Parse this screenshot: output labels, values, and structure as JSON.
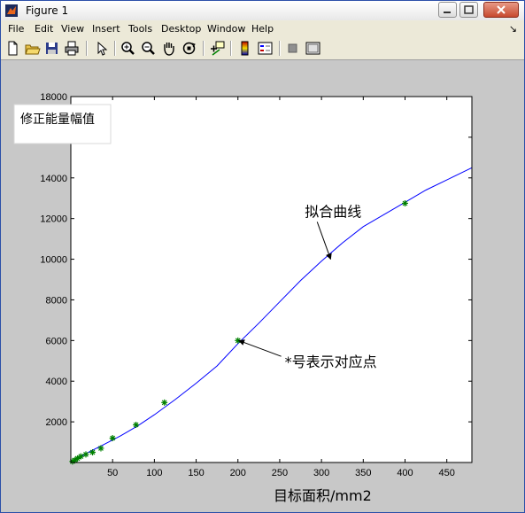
{
  "window": {
    "title": "Figure 1",
    "buttons": {
      "minimize": "0",
      "maximize": "1",
      "close": "r"
    }
  },
  "menu": {
    "items": [
      "File",
      "Edit",
      "View",
      "Insert",
      "Tools",
      "Desktop",
      "Window",
      "Help"
    ],
    "overflow_arrow": "↘"
  },
  "toolbar": {
    "icons": [
      "new-figure-icon",
      "open-file-icon",
      "save-icon",
      "print-icon",
      "pointer-icon",
      "zoom-in-icon",
      "zoom-out-icon",
      "pan-hand-icon",
      "rotate-3d-icon",
      "data-cursor-icon",
      "colorbar-icon",
      "legend-icon",
      "hide-plot-tools-icon",
      "show-plot-tools-icon"
    ]
  },
  "colors": {
    "curve": "#0000ff",
    "markers": "#008000",
    "figure_bg": "#c8c8c8"
  },
  "chart_data": {
    "type": "line",
    "title": "",
    "ylabel_box": "修正能量幅值",
    "xlabel": "目标面积/mm2",
    "xlim": [
      0,
      480
    ],
    "ylim": [
      0,
      18000
    ],
    "xticks": [
      50,
      100,
      150,
      200,
      250,
      300,
      350,
      400,
      450
    ],
    "yticks": [
      2000,
      4000,
      6000,
      8000,
      10000,
      12000,
      14000,
      16000,
      18000
    ],
    "grid": false,
    "series": [
      {
        "style": "line",
        "x": [
          0,
          10,
          20,
          40,
          60,
          80,
          100,
          125,
          150,
          175,
          200,
          225,
          250,
          275,
          300,
          325,
          350,
          375,
          400,
          425,
          450,
          480
        ],
        "y": [
          0,
          250,
          480,
          900,
          1320,
          1800,
          2350,
          3100,
          3900,
          4750,
          5850,
          6850,
          7900,
          8950,
          9900,
          10800,
          11600,
          12200,
          12800,
          13400,
          13900,
          14500
        ]
      },
      {
        "style": "markers",
        "marker": "*",
        "x": [
          2,
          5,
          8,
          12,
          18,
          26,
          36,
          50,
          78,
          112,
          200,
          400
        ],
        "y": [
          50,
          120,
          200,
          300,
          400,
          500,
          700,
          1200,
          1850,
          2950,
          6000,
          12750
        ]
      }
    ],
    "annotations": [
      {
        "text": "拟合曲线",
        "text_x": 280,
        "text_y": 12100,
        "arrow_to_x": 311,
        "arrow_to_y": 10000
      },
      {
        "text": "*号表示对应点",
        "text_x": 256,
        "text_y": 4700,
        "arrow_to_x": 201,
        "arrow_to_y": 6000
      }
    ]
  }
}
